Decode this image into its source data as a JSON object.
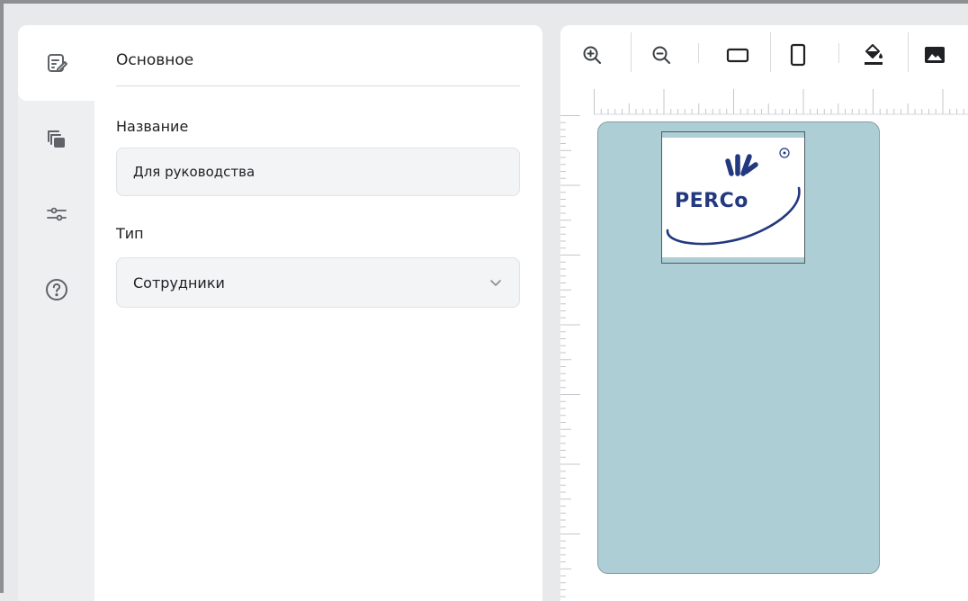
{
  "sidebar": {
    "items": [
      {
        "icon": "edit-form-icon",
        "active": true
      },
      {
        "icon": "copy-stack-icon",
        "active": false
      },
      {
        "icon": "sliders-icon",
        "active": false
      },
      {
        "icon": "help-icon",
        "active": false
      }
    ]
  },
  "main": {
    "section_title": "Основное",
    "name_label": "Название",
    "name_value": "Для руководства",
    "type_label": "Тип",
    "type_value": "Сотрудники"
  },
  "toolbar": {
    "tools": [
      "zoom-in-icon",
      "zoom-out-icon",
      "landscape-orientation-icon",
      "portrait-orientation-icon",
      "fill-color-icon",
      "image-icon"
    ]
  },
  "card": {
    "background": "#adced5",
    "logo_text": "PERCo",
    "logo_color": "#22387f"
  },
  "colors": {
    "accent": "#22387f",
    "panel_bg": "#ffffff",
    "rail_bg": "#eeeff1",
    "icon": "#5f6368"
  }
}
